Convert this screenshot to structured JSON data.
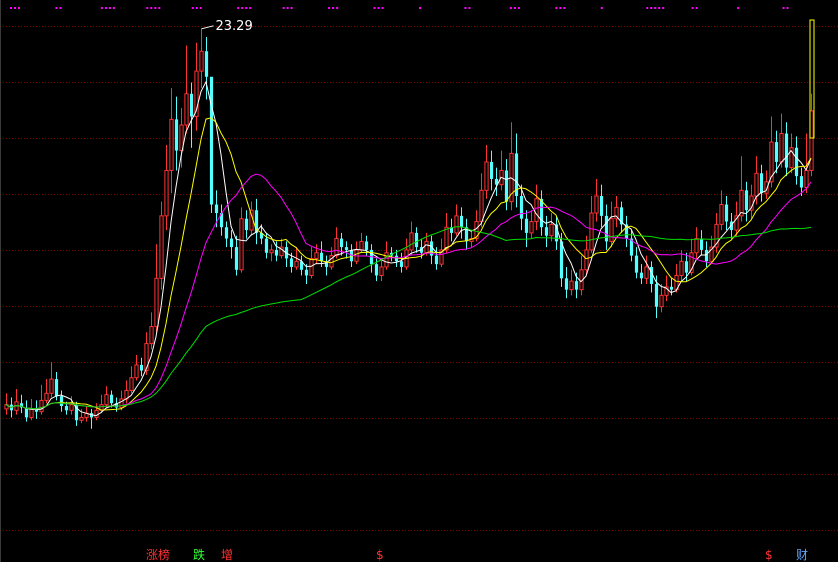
{
  "chart_data": {
    "type": "candlestick",
    "title": "",
    "xlabel": "",
    "ylabel": "",
    "ylim": [
      5.0,
      23.6
    ],
    "grid": "dotted-horizontal",
    "peak_label": "23.29",
    "colors": {
      "background": "#000000",
      "up": "#ff3232",
      "down": "#54ffff",
      "grid": "#7a0000",
      "ma_white": "#ffffff",
      "ma_yellow": "#ffff00",
      "ma_magenta": "#ff00ff",
      "ma_green": "#00dd00",
      "marker": "#ff00ff"
    },
    "candles": [
      [
        9.9,
        10.05,
        10.45,
        9.7
      ],
      [
        10.05,
        9.85,
        10.3,
        9.6
      ],
      [
        9.85,
        10.15,
        10.6,
        9.7
      ],
      [
        10.1,
        9.95,
        10.4,
        9.75
      ],
      [
        9.95,
        9.6,
        10.2,
        9.45
      ],
      [
        9.6,
        9.9,
        10.25,
        9.5
      ],
      [
        9.9,
        9.8,
        10.2,
        9.55
      ],
      [
        9.8,
        10.2,
        10.75,
        9.7
      ],
      [
        10.2,
        10.45,
        10.95,
        10.1
      ],
      [
        10.45,
        10.95,
        11.55,
        10.3
      ],
      [
        10.95,
        10.35,
        11.2,
        10.2
      ],
      [
        10.35,
        10.0,
        10.55,
        9.8
      ],
      [
        10.0,
        9.85,
        10.15,
        9.7
      ],
      [
        9.85,
        10.05,
        10.35,
        9.7
      ],
      [
        10.05,
        9.5,
        10.15,
        9.3
      ],
      [
        9.5,
        9.6,
        9.9,
        9.4
      ],
      [
        9.6,
        9.75,
        10.0,
        9.45
      ],
      [
        9.75,
        9.6,
        9.9,
        9.2
      ],
      [
        9.6,
        9.85,
        10.1,
        9.5
      ],
      [
        9.85,
        10.05,
        10.4,
        9.75
      ],
      [
        10.05,
        10.4,
        10.7,
        9.95
      ],
      [
        10.4,
        10.1,
        10.55,
        9.95
      ],
      [
        10.1,
        9.95,
        10.3,
        9.8
      ],
      [
        9.95,
        10.25,
        10.55,
        9.85
      ],
      [
        10.25,
        10.55,
        10.9,
        10.1
      ],
      [
        10.55,
        11.0,
        11.4,
        10.45
      ],
      [
        11.0,
        11.45,
        11.8,
        10.9
      ],
      [
        11.45,
        11.25,
        11.7,
        11.05
      ],
      [
        11.25,
        12.2,
        12.6,
        11.1
      ],
      [
        12.2,
        12.8,
        13.3,
        12.0
      ],
      [
        12.8,
        14.5,
        15.7,
        12.6
      ],
      [
        14.5,
        16.7,
        17.2,
        14.1
      ],
      [
        16.7,
        18.3,
        19.2,
        16.2
      ],
      [
        18.3,
        20.1,
        21.2,
        17.5
      ],
      [
        20.1,
        19.0,
        20.9,
        18.3
      ],
      [
        19.0,
        19.9,
        20.5,
        18.4
      ],
      [
        19.9,
        21.0,
        22.7,
        19.6
      ],
      [
        21.0,
        20.2,
        21.4,
        19.1
      ],
      [
        20.2,
        21.8,
        22.8,
        19.7
      ],
      [
        21.8,
        22.5,
        23.29,
        21.2
      ],
      [
        22.5,
        21.6,
        23.0,
        20.8
      ],
      [
        21.6,
        17.1,
        18.1,
        16.8
      ],
      [
        17.1,
        16.8,
        17.6,
        16.3
      ],
      [
        16.8,
        16.3,
        17.1,
        16.0
      ],
      [
        16.3,
        15.9,
        16.5,
        15.6
      ],
      [
        15.9,
        15.6,
        16.2,
        15.2
      ],
      [
        15.6,
        14.8,
        16.0,
        14.6
      ],
      [
        14.8,
        16.6,
        17.0,
        14.7
      ],
      [
        16.6,
        16.2,
        16.9,
        15.9
      ],
      [
        16.2,
        16.9,
        17.2,
        16.0
      ],
      [
        16.9,
        16.1,
        17.3,
        15.7
      ],
      [
        16.1,
        15.9,
        16.4,
        15.7
      ],
      [
        15.9,
        15.4,
        16.1,
        15.2
      ],
      [
        15.4,
        15.5,
        15.7,
        15.1
      ],
      [
        15.5,
        15.3,
        15.8,
        15.1
      ],
      [
        15.3,
        15.6,
        15.9,
        15.2
      ],
      [
        15.6,
        15.2,
        15.8,
        14.9
      ],
      [
        15.2,
        14.9,
        15.4,
        14.7
      ],
      [
        14.9,
        15.1,
        15.6,
        14.8
      ],
      [
        15.1,
        14.8,
        15.3,
        14.6
      ],
      [
        14.8,
        14.6,
        15.0,
        14.3
      ],
      [
        14.6,
        15.2,
        15.6,
        14.5
      ],
      [
        15.2,
        15.4,
        15.7,
        15.0
      ],
      [
        15.4,
        15.1,
        15.8,
        14.9
      ],
      [
        15.1,
        14.9,
        15.3,
        14.6
      ],
      [
        14.9,
        15.3,
        15.6,
        14.8
      ],
      [
        15.3,
        15.9,
        16.3,
        15.2
      ],
      [
        15.9,
        15.6,
        16.1,
        15.3
      ],
      [
        15.6,
        15.5,
        15.8,
        15.2
      ],
      [
        15.5,
        15.1,
        15.7,
        14.9
      ],
      [
        15.1,
        15.5,
        15.8,
        15.0
      ],
      [
        15.5,
        15.8,
        16.1,
        15.4
      ],
      [
        15.8,
        15.5,
        16.0,
        15.3
      ],
      [
        15.5,
        15.0,
        15.7,
        14.7
      ],
      [
        15.0,
        14.6,
        15.2,
        14.4
      ],
      [
        14.6,
        14.9,
        15.2,
        14.4
      ],
      [
        14.9,
        15.4,
        15.8,
        14.8
      ],
      [
        15.4,
        15.3,
        15.6,
        15.1
      ],
      [
        15.3,
        15.1,
        15.5,
        14.9
      ],
      [
        15.1,
        14.9,
        15.4,
        14.7
      ],
      [
        14.9,
        15.5,
        15.9,
        14.8
      ],
      [
        15.5,
        16.1,
        16.5,
        15.3
      ],
      [
        16.1,
        15.6,
        16.3,
        15.4
      ],
      [
        15.6,
        15.4,
        15.9,
        15.2
      ],
      [
        15.4,
        15.8,
        16.1,
        15.3
      ],
      [
        15.8,
        15.3,
        16.0,
        15.0
      ],
      [
        15.3,
        15.0,
        15.6,
        14.8
      ],
      [
        15.0,
        15.5,
        15.9,
        14.9
      ],
      [
        15.5,
        16.3,
        16.8,
        15.4
      ],
      [
        16.3,
        16.1,
        16.6,
        15.8
      ],
      [
        16.1,
        16.7,
        17.1,
        16.0
      ],
      [
        16.7,
        16.3,
        17.0,
        15.9
      ],
      [
        16.3,
        15.8,
        16.6,
        15.5
      ],
      [
        15.8,
        15.9,
        16.2,
        15.6
      ],
      [
        15.9,
        16.5,
        16.9,
        15.8
      ],
      [
        16.5,
        17.6,
        18.2,
        16.3
      ],
      [
        17.6,
        18.6,
        19.2,
        17.3
      ],
      [
        18.6,
        18.0,
        19.0,
        17.6
      ],
      [
        18.0,
        17.8,
        18.4,
        17.4
      ],
      [
        17.8,
        18.3,
        19.0,
        17.6
      ],
      [
        18.3,
        17.2,
        18.7,
        16.9
      ],
      [
        17.2,
        18.9,
        20.0,
        16.9
      ],
      [
        18.9,
        17.4,
        19.6,
        17.0
      ],
      [
        17.4,
        16.6,
        17.8,
        16.2
      ],
      [
        16.6,
        16.1,
        16.9,
        15.6
      ],
      [
        16.1,
        16.5,
        16.9,
        15.9
      ],
      [
        16.5,
        17.3,
        17.8,
        16.2
      ],
      [
        17.3,
        16.3,
        17.6,
        16.0
      ],
      [
        16.3,
        16.0,
        16.7,
        15.6
      ],
      [
        16.0,
        16.4,
        16.8,
        15.8
      ],
      [
        16.4,
        15.8,
        16.7,
        15.5
      ],
      [
        15.8,
        14.5,
        16.1,
        14.2
      ],
      [
        14.5,
        14.1,
        14.9,
        13.8
      ],
      [
        14.1,
        14.4,
        14.8,
        13.9
      ],
      [
        14.4,
        14.1,
        14.7,
        13.8
      ],
      [
        14.1,
        14.8,
        15.3,
        13.9
      ],
      [
        14.8,
        15.5,
        16.0,
        14.6
      ],
      [
        15.5,
        16.8,
        17.4,
        15.4
      ],
      [
        16.8,
        17.4,
        18.0,
        16.5
      ],
      [
        17.4,
        16.7,
        17.8,
        16.3
      ],
      [
        16.7,
        15.8,
        17.1,
        15.5
      ],
      [
        15.8,
        16.6,
        17.2,
        15.6
      ],
      [
        16.6,
        17.0,
        17.4,
        16.3
      ],
      [
        17.0,
        16.4,
        17.2,
        16.1
      ],
      [
        16.4,
        15.9,
        16.7,
        15.6
      ],
      [
        15.9,
        15.3,
        16.2,
        15.1
      ],
      [
        15.3,
        14.7,
        15.6,
        14.5
      ],
      [
        14.7,
        14.5,
        15.0,
        14.3
      ],
      [
        14.5,
        14.9,
        15.3,
        14.3
      ],
      [
        14.9,
        14.3,
        15.1,
        14.0
      ],
      [
        14.3,
        13.5,
        14.6,
        13.1
      ],
      [
        13.5,
        13.9,
        14.3,
        13.3
      ],
      [
        13.9,
        14.2,
        14.6,
        13.7
      ],
      [
        14.2,
        14.1,
        14.5,
        13.9
      ],
      [
        14.1,
        14.6,
        15.0,
        14.0
      ],
      [
        14.6,
        15.1,
        15.5,
        14.4
      ],
      [
        15.1,
        14.7,
        15.4,
        14.4
      ],
      [
        14.7,
        15.4,
        15.9,
        14.6
      ],
      [
        15.4,
        15.9,
        16.3,
        15.2
      ],
      [
        15.9,
        15.5,
        16.2,
        15.3
      ],
      [
        15.5,
        15.1,
        15.8,
        14.9
      ],
      [
        15.1,
        15.6,
        16.0,
        15.0
      ],
      [
        15.6,
        16.4,
        16.8,
        15.4
      ],
      [
        16.4,
        17.1,
        17.6,
        16.2
      ],
      [
        17.1,
        16.5,
        17.4,
        16.2
      ],
      [
        16.5,
        16.2,
        16.8,
        15.9
      ],
      [
        16.2,
        16.7,
        17.2,
        16.0
      ],
      [
        16.7,
        17.6,
        18.8,
        16.5
      ],
      [
        17.6,
        16.9,
        17.9,
        16.5
      ],
      [
        16.9,
        17.4,
        17.8,
        16.6
      ],
      [
        17.4,
        18.2,
        18.8,
        17.1
      ],
      [
        18.2,
        17.5,
        18.5,
        17.2
      ],
      [
        17.5,
        17.9,
        18.3,
        17.3
      ],
      [
        17.9,
        19.3,
        20.2,
        17.7
      ],
      [
        19.3,
        18.6,
        19.7,
        18.2
      ],
      [
        18.6,
        19.6,
        20.3,
        18.4
      ],
      [
        19.6,
        18.4,
        20.0,
        18.1
      ],
      [
        18.4,
        19.1,
        19.6,
        18.2
      ],
      [
        19.1,
        18.1,
        19.5,
        17.8
      ],
      [
        18.1,
        17.7,
        18.4,
        17.4
      ],
      [
        17.7,
        18.3,
        19.6,
        17.5
      ],
      [
        18.3,
        20.4,
        21.0,
        18.1
      ]
    ],
    "moving_averages": [
      {
        "name": "",
        "color": "#ffffff",
        "period": 5
      },
      {
        "name": "",
        "color": "#ffff00",
        "period": 10
      },
      {
        "name": "",
        "color": "#ff00ff",
        "period": 20
      },
      {
        "name": "",
        "color": "#00dd00",
        "period": 60
      }
    ],
    "top_marker_groups": [
      {
        "count": 3
      },
      {
        "count": 2
      },
      {
        "count": 4
      },
      {
        "count": 4
      },
      {
        "count": 3
      },
      {
        "count": 4
      },
      {
        "count": 3
      },
      {
        "count": 3
      },
      {
        "count": 3
      },
      {
        "count": 1
      },
      {
        "count": 2
      },
      {
        "count": 3
      },
      {
        "count": 3
      },
      {
        "count": 1
      },
      {
        "count": 5
      },
      {
        "count": 2
      },
      {
        "count": 1
      },
      {
        "count": 2
      }
    ],
    "bottom_badges": [
      {
        "text": "涨榜",
        "color": "#ff3232"
      },
      {
        "text": "跌",
        "color": "#32ff32"
      },
      {
        "text": "增",
        "color": "#ff3232"
      },
      {
        "text": "$",
        "color": "#ff3232"
      },
      {
        "text": "$",
        "color": "#ff3232"
      },
      {
        "text": "财",
        "color": "#5fa8ff"
      }
    ]
  }
}
